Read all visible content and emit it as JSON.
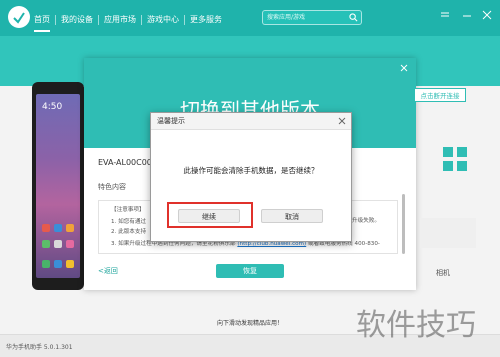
{
  "app": {
    "nav": [
      {
        "label": "首页",
        "active": true
      },
      {
        "label": "我的设备"
      },
      {
        "label": "应用市场"
      },
      {
        "label": "游戏中心"
      },
      {
        "label": "更多服务"
      }
    ],
    "search_placeholder": "搜索应用/游戏"
  },
  "phone": {
    "time": "4:50"
  },
  "background_panel": {
    "title": "切换到其他版本",
    "model": "EVA-AL00C00B",
    "feature_heading": "特色内容",
    "notes": {
      "heading": "【注意事项】",
      "line1_prefix": "1. 如您有通过",
      "line2_prefix": "2. 此版本支持",
      "line3": "3. 如果升级过程中遇到任何问题，请至花粉俱乐部",
      "link": "(http://club.huawei.com)",
      "line3_suffix": "或者致电服务热线 400-830-"
    },
    "side_note": "升级失败。",
    "back_label": "<返回",
    "restore_label": "恢复"
  },
  "right_panel": {
    "link_button": "点击断开连接",
    "item_label": "相机"
  },
  "dialog": {
    "title": "温馨提示",
    "message": "此操作可能会清除手机数据，是否继续？",
    "continue_label": "继续",
    "cancel_label": "取消"
  },
  "bottom_hint": "向下滑动发现精品应用！",
  "footer": {
    "version": "华为手机助手 5.0.1.301"
  },
  "watermark": "软件技巧",
  "colors": {
    "primary": "#1fb3ab",
    "highlight_box": "#e0312b"
  }
}
